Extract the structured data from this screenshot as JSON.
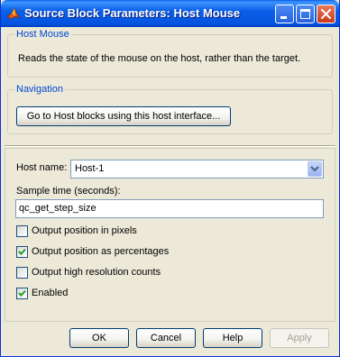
{
  "window": {
    "title": "Source Block Parameters: Host Mouse",
    "colors": {
      "titlebar": "#0a5fe8",
      "face": "#ece9d8",
      "group_title": "#0046d5"
    }
  },
  "description_group": {
    "title": "Host Mouse",
    "text": "Reads the state of the mouse on the host, rather than the target."
  },
  "navigation_group": {
    "title": "Navigation",
    "button_label": "Go to Host blocks using this host interface..."
  },
  "parameters": {
    "host_name_label": "Host name:",
    "host_name_value": "Host-1",
    "sample_time_label": "Sample time (seconds):",
    "sample_time_value": "qc_get_step_size",
    "checkboxes": [
      {
        "label": "Output position in pixels",
        "checked": false
      },
      {
        "label": "Output position as percentages",
        "checked": true
      },
      {
        "label": "Output high resolution counts",
        "checked": false
      },
      {
        "label": "Enabled",
        "checked": true
      }
    ]
  },
  "buttons": {
    "ok": "OK",
    "cancel": "Cancel",
    "help": "Help",
    "apply": "Apply"
  },
  "icons": {
    "app": "matlab-logo-icon",
    "minimize": "minimize-icon",
    "maximize": "maximize-icon",
    "close": "close-icon",
    "dropdown": "chevron-down-icon",
    "check": "checkmark-icon"
  }
}
